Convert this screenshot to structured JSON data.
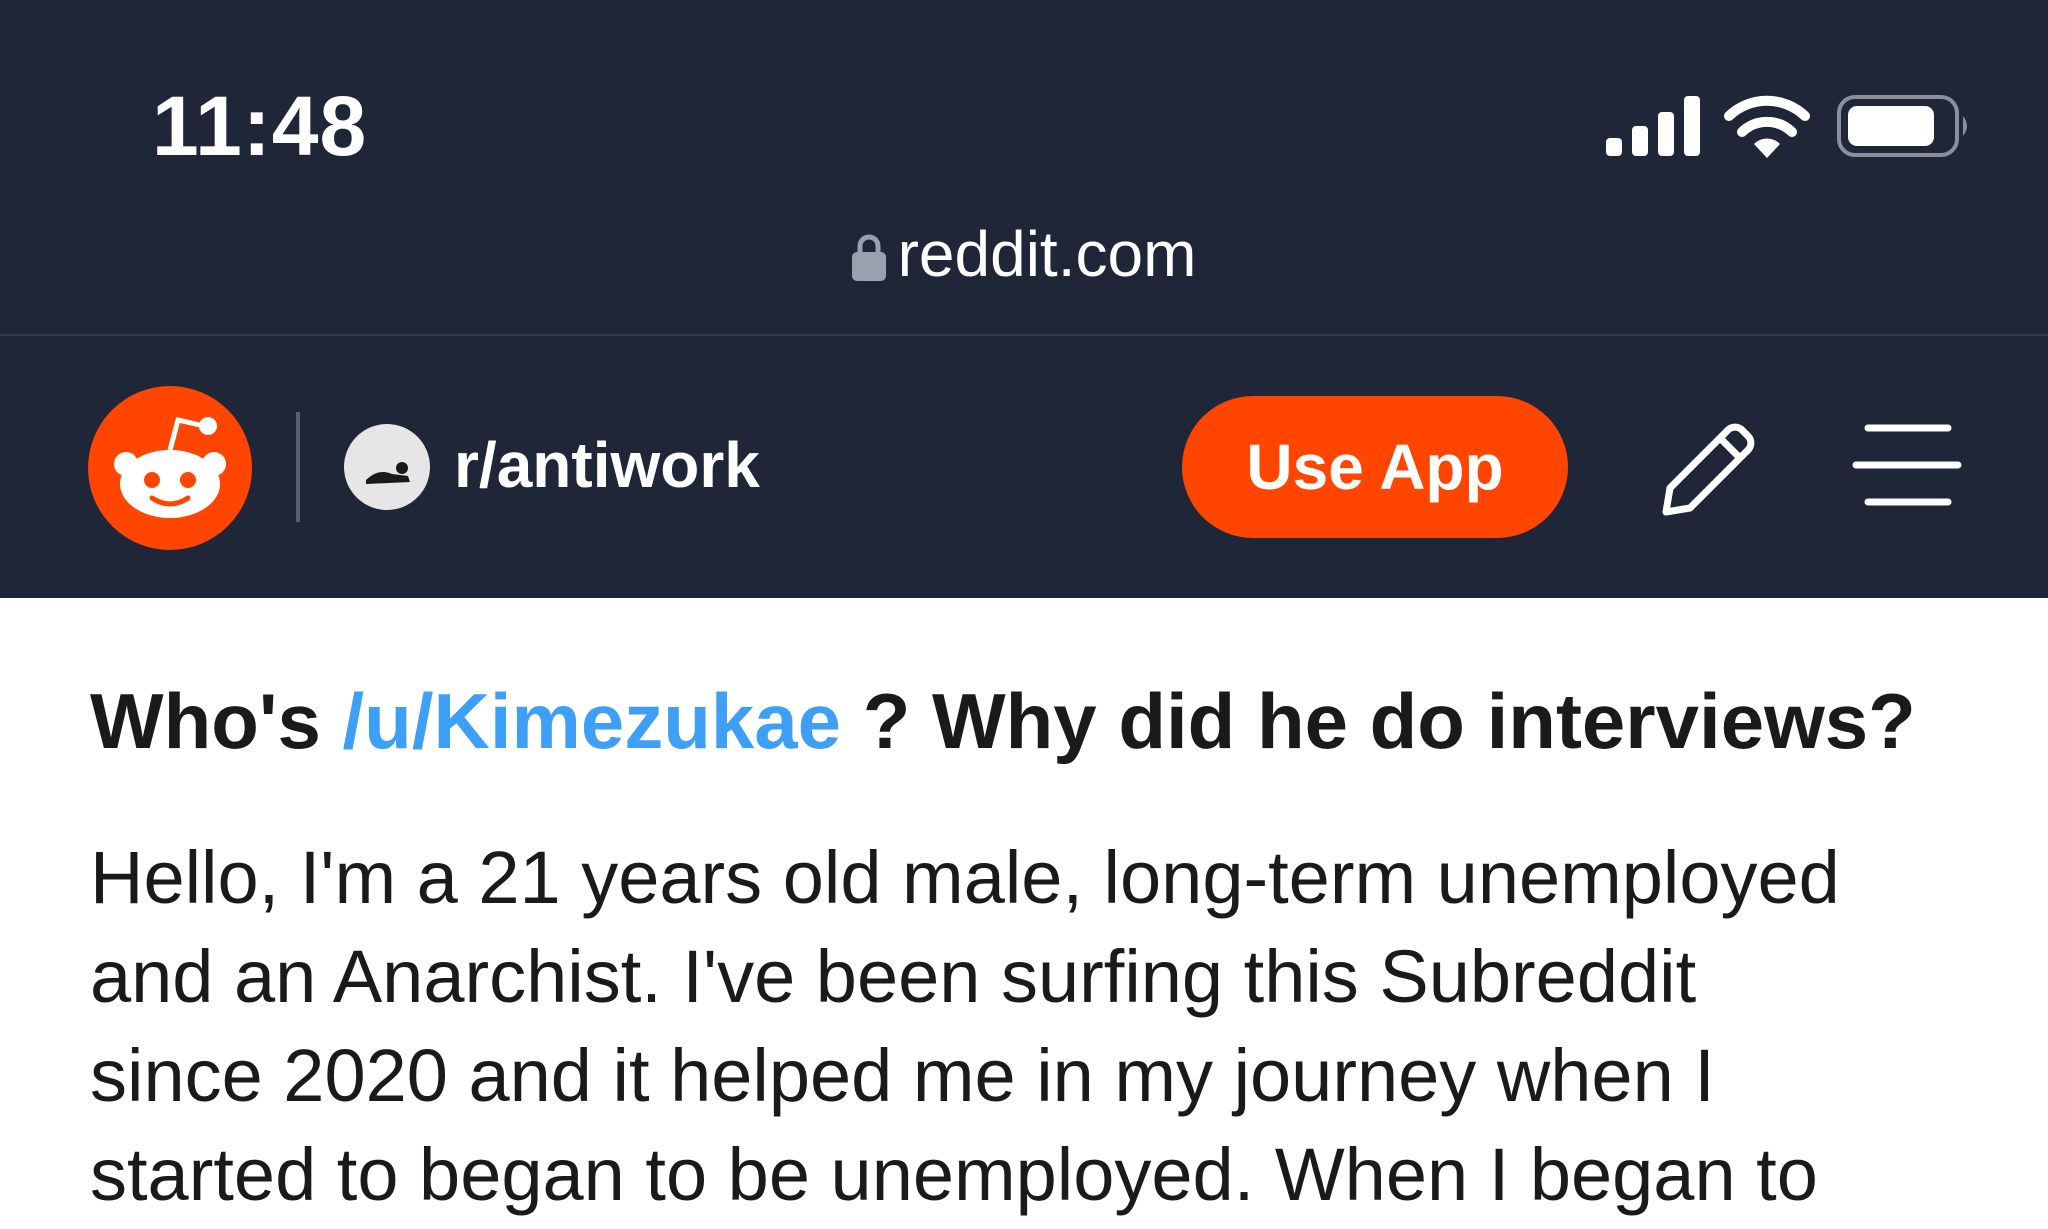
{
  "status_bar": {
    "time": "11:48",
    "signal_icon": "cellular-signal-icon",
    "wifi_icon": "wifi-icon",
    "battery_icon": "battery-icon"
  },
  "browser": {
    "url": "reddit.com",
    "lock_icon": "lock-icon"
  },
  "header": {
    "logo_icon": "reddit-snoo-icon",
    "subreddit": "r/antiwork",
    "use_app_label": "Use App",
    "edit_icon": "pencil-icon",
    "menu_icon": "hamburger-menu-icon",
    "accent_color": "#ff4500",
    "background_color": "#1f2638"
  },
  "post": {
    "title_prefix": "Who's ",
    "title_user": "/u/Kimezukae",
    "title_suffix": " ? Why did he do interviews?",
    "link_color": "#3d9ff5",
    "body_lines": [
      "Hello, I'm a 21 years old male, long-term unemployed",
      "and an Anarchist. I've been surfing this Subreddit",
      "since 2020 and it helped me in my journey when I",
      "started to began to be unemployed. When I began to"
    ]
  }
}
